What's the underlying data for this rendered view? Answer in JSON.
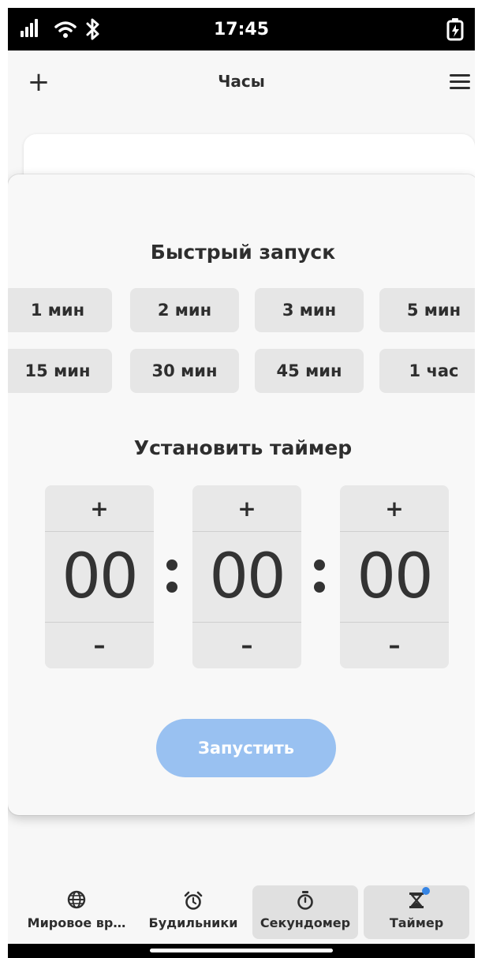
{
  "status_bar": {
    "time": "17:45"
  },
  "header": {
    "title": "Часы"
  },
  "quick_start": {
    "title": "Быстрый запуск",
    "buttons": [
      "1 мин",
      "2 мин",
      "3 мин",
      "5 мин",
      "15 мин",
      "30 мин",
      "45 мин",
      "1 час"
    ]
  },
  "set_timer": {
    "title": "Установить таймер",
    "hours": "00",
    "minutes": "00",
    "seconds": "00",
    "plus": "+",
    "minus": "–"
  },
  "start_label": "Запустить",
  "colors": {
    "accent": "#3584e4",
    "start_button": "#99c1f1"
  },
  "tabs": [
    {
      "label": "Мировое вр…",
      "icon": "globe-icon"
    },
    {
      "label": "Будильники",
      "icon": "alarm-clock-icon"
    },
    {
      "label": "Секундомер",
      "icon": "stopwatch-icon"
    },
    {
      "label": "Таймер",
      "icon": "hourglass-icon",
      "active": true
    }
  ]
}
